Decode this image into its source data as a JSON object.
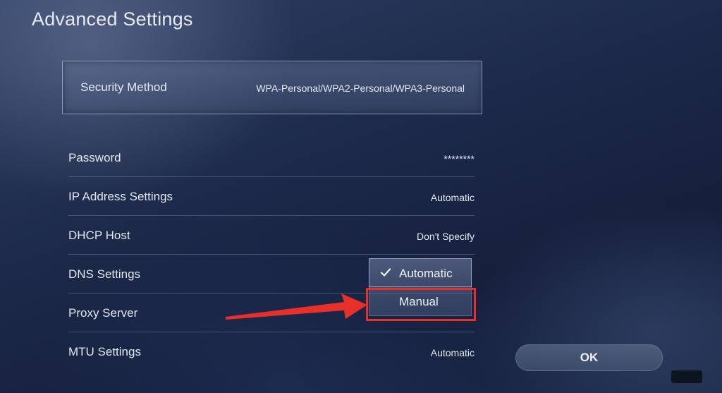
{
  "page": {
    "title": "Advanced Settings"
  },
  "security": {
    "label": "Security Method",
    "value": "WPA-Personal/WPA2-Personal/WPA3-Personal"
  },
  "settings": [
    {
      "label": "Password",
      "value": "********"
    },
    {
      "label": "IP Address Settings",
      "value": "Automatic"
    },
    {
      "label": "DHCP Host",
      "value": "Don't Specify"
    },
    {
      "label": "DNS Settings",
      "value": ""
    },
    {
      "label": "Proxy Server",
      "value": ""
    },
    {
      "label": "MTU Settings",
      "value": "Automatic"
    }
  ],
  "dns_dropdown": {
    "options": [
      {
        "label": "Automatic",
        "selected": true
      },
      {
        "label": "Manual",
        "selected": false
      }
    ]
  },
  "buttons": {
    "ok_label": "OK"
  },
  "colors": {
    "highlight": "#e8302a",
    "background": "#1d2a4b"
  },
  "icons": {
    "check": "check-icon",
    "arrow": "red-arrow-annotation"
  }
}
